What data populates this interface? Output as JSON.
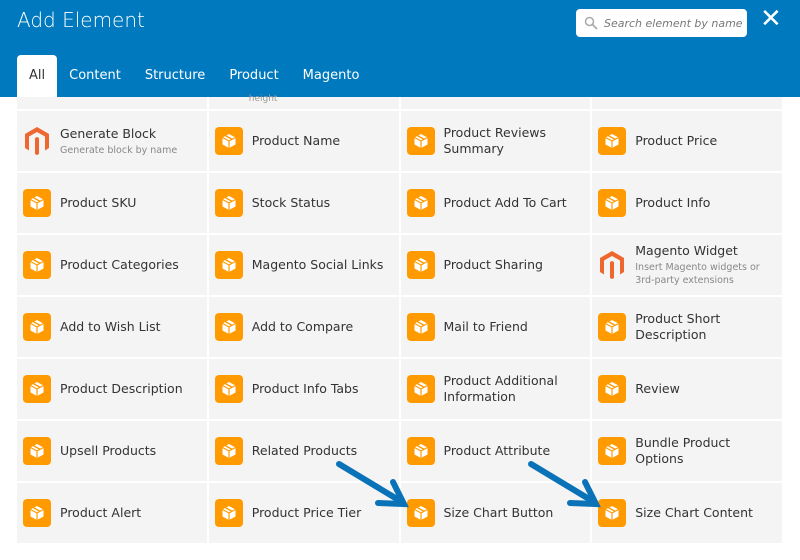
{
  "header": {
    "title": "Add Element",
    "search_placeholder": "Search element by name",
    "close": "✕"
  },
  "tabs": [
    {
      "label": "All",
      "active": true
    },
    {
      "label": "Content"
    },
    {
      "label": "Structure"
    },
    {
      "label": "Product"
    },
    {
      "label": "Magento"
    }
  ],
  "partial_row_text": "height",
  "elements": [
    {
      "name": "Generate Block",
      "desc": "Generate block by name",
      "icon": "magento"
    },
    {
      "name": "Product Name",
      "icon": "box"
    },
    {
      "name": "Product Reviews Summary",
      "icon": "box"
    },
    {
      "name": "Product Price",
      "icon": "box"
    },
    {
      "name": "Product SKU",
      "icon": "box"
    },
    {
      "name": "Stock Status",
      "icon": "box"
    },
    {
      "name": "Product Add To Cart",
      "icon": "box"
    },
    {
      "name": "Product Info",
      "icon": "box"
    },
    {
      "name": "Product Categories",
      "icon": "box"
    },
    {
      "name": "Magento Social Links",
      "icon": "box"
    },
    {
      "name": "Product Sharing",
      "icon": "box"
    },
    {
      "name": "Magento Widget",
      "desc": "Insert Magento widgets or 3rd-party extensions",
      "icon": "magento"
    },
    {
      "name": "Add to Wish List",
      "icon": "box"
    },
    {
      "name": "Add to Compare",
      "icon": "box"
    },
    {
      "name": "Mail to Friend",
      "icon": "box"
    },
    {
      "name": "Product Short Description",
      "icon": "box"
    },
    {
      "name": "Product Description",
      "icon": "box"
    },
    {
      "name": "Product Info Tabs",
      "icon": "box"
    },
    {
      "name": "Product Additional Information",
      "icon": "box"
    },
    {
      "name": "Review",
      "icon": "box"
    },
    {
      "name": "Upsell Products",
      "icon": "box"
    },
    {
      "name": "Related Products",
      "icon": "box"
    },
    {
      "name": "Product Attribute",
      "icon": "box"
    },
    {
      "name": "Bundle Product Options",
      "icon": "box"
    },
    {
      "name": "Product Alert",
      "icon": "box"
    },
    {
      "name": "Product Price Tier",
      "icon": "box"
    },
    {
      "name": "Size Chart Button",
      "icon": "box"
    },
    {
      "name": "Size Chart Content",
      "icon": "box"
    }
  ],
  "colors": {
    "header": "#0079be",
    "icon": "#ff9a00",
    "magento": "#ee672f",
    "arrow": "#0a73b8"
  }
}
